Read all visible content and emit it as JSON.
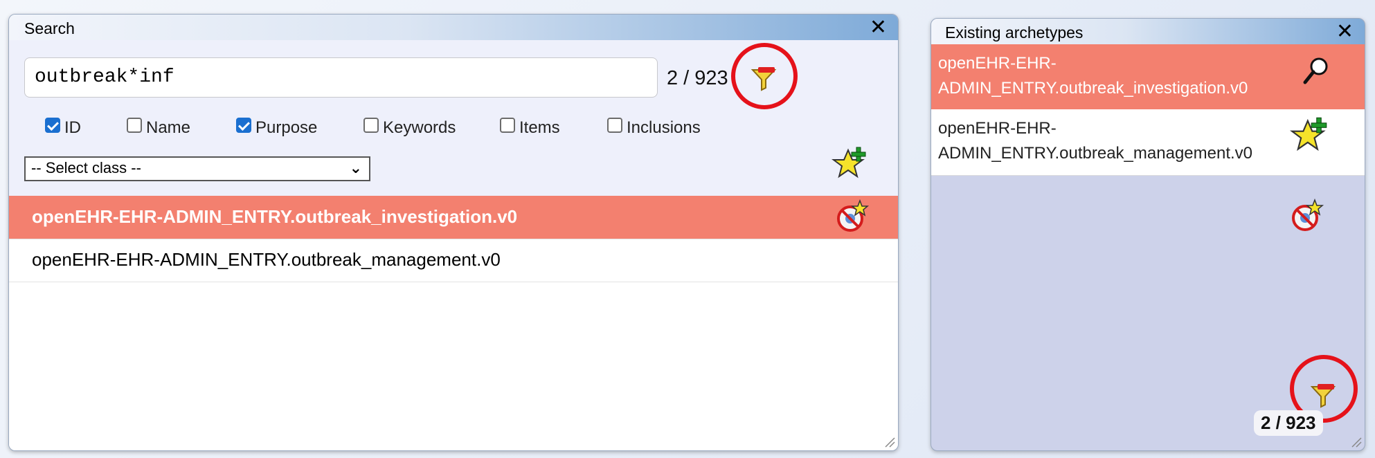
{
  "search_panel": {
    "title": "Search",
    "close_icon": "✕",
    "query": "outbreak*inf",
    "count": "2 / 923",
    "checkboxes": [
      {
        "label": "ID",
        "checked": true
      },
      {
        "label": "Name",
        "checked": false
      },
      {
        "label": "Purpose",
        "checked": true
      },
      {
        "label": "Keywords",
        "checked": false
      },
      {
        "label": "Items",
        "checked": false
      },
      {
        "label": "Inclusions",
        "checked": false
      }
    ],
    "class_select": "-- Select class --",
    "results": [
      {
        "label": "openEHR-EHR-ADMIN_ENTRY.outbreak_investigation.v0",
        "selected": true
      },
      {
        "label": "openEHR-EHR-ADMIN_ENTRY.outbreak_management.v0",
        "selected": false
      }
    ]
  },
  "archetypes_panel": {
    "title": "Existing archetypes",
    "close_icon": "✕",
    "items": [
      {
        "line1": "openEHR-EHR-",
        "line2": "ADMIN_ENTRY.outbreak_investigation.v0",
        "selected": true
      },
      {
        "line1": "openEHR-EHR-",
        "line2": "ADMIN_ENTRY.outbreak_management.v0",
        "selected": false
      }
    ],
    "count": "2 / 923"
  },
  "colors": {
    "selected_row": "#f3806f",
    "highlight_ring": "#e5121a"
  },
  "icons": [
    "filter-icon",
    "add-star-icon",
    "exclude-star-icon",
    "magnifier-icon",
    "close-icon",
    "resize-grip-icon"
  ]
}
